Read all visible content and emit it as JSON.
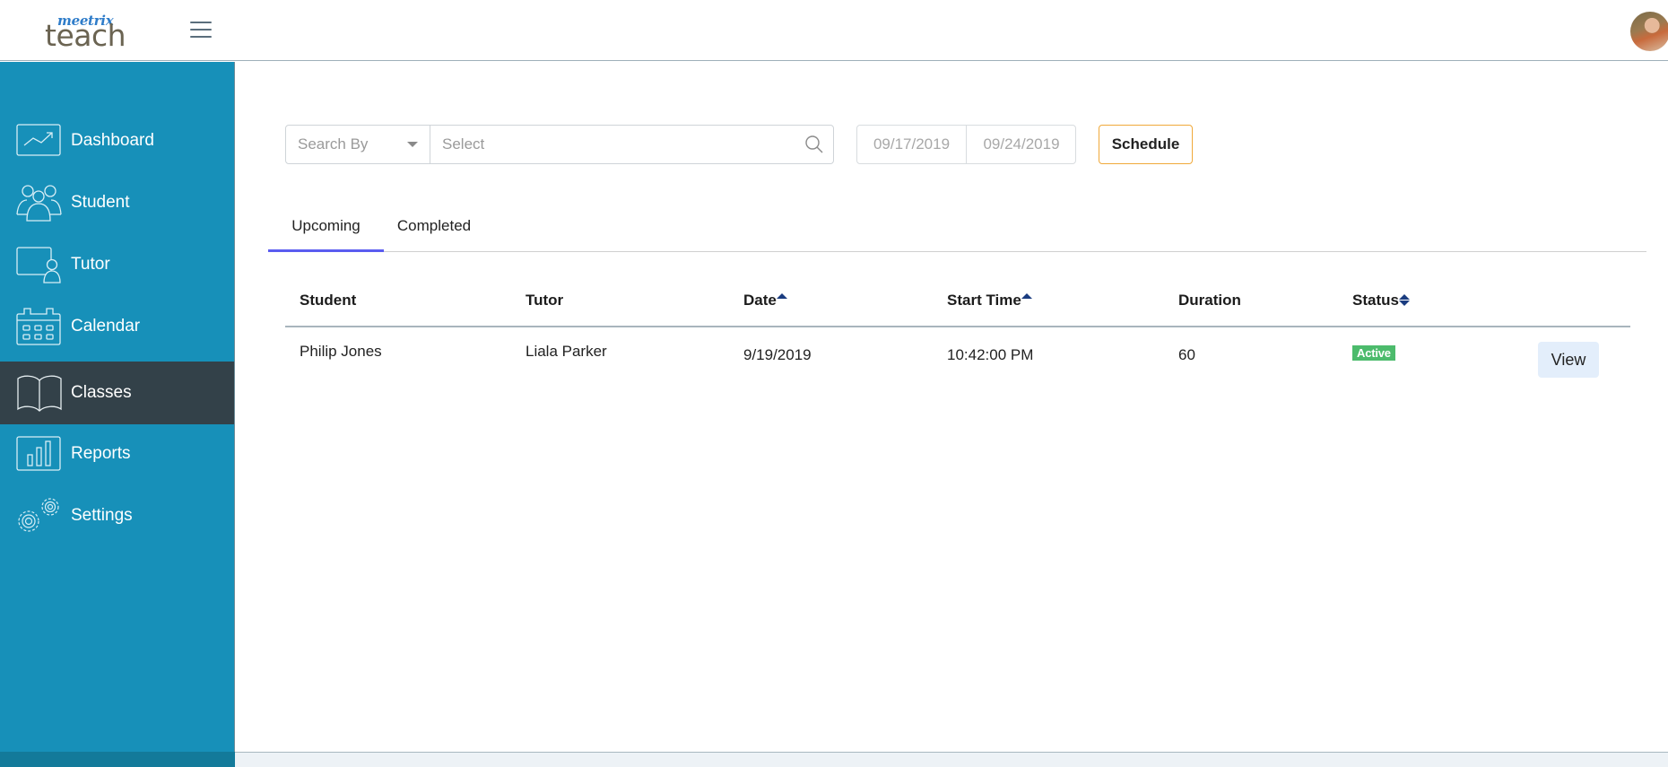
{
  "header": {
    "logo_small": "meetrix",
    "logo_big": "teach",
    "menu_icon": "hamburger-icon",
    "avatar": "user-avatar"
  },
  "sidebar": {
    "items": [
      {
        "label": "Dashboard",
        "icon": "trend-chart-icon",
        "active": false
      },
      {
        "label": "Student",
        "icon": "users-group-icon",
        "active": false
      },
      {
        "label": "Tutor",
        "icon": "tutor-board-icon",
        "active": false
      },
      {
        "label": "Calendar",
        "icon": "calendar-icon",
        "active": false
      },
      {
        "label": "Classes",
        "icon": "open-book-icon",
        "active": true
      },
      {
        "label": "Reports",
        "icon": "bar-chart-icon",
        "active": false
      },
      {
        "label": "Settings",
        "icon": "gears-icon",
        "active": false
      }
    ]
  },
  "filters": {
    "search_by_placeholder": "Search By",
    "search_placeholder": "Select",
    "date_from": "09/17/2019",
    "date_to": "09/24/2019",
    "schedule_label": "Schedule"
  },
  "tabs": [
    {
      "label": "Upcoming",
      "active": true
    },
    {
      "label": "Completed",
      "active": false
    }
  ],
  "table": {
    "columns": [
      "Student",
      "Tutor",
      "Date",
      "Start Time",
      "Duration",
      "Status"
    ],
    "rows": [
      {
        "student": "Philip Jones",
        "tutor": "Liala Parker",
        "date": "9/19/2019",
        "start_time": "10:42:00 PM",
        "duration": "60",
        "status": "Active",
        "action": "View"
      }
    ]
  },
  "colors": {
    "sidebar": "#1790b9",
    "sidebar_active": "#334149",
    "tab_indicator": "#5a5cf0",
    "schedule_border": "#f0a93a",
    "status_active": "#4cbb6c",
    "sort_arrow": "#1a3c80"
  }
}
